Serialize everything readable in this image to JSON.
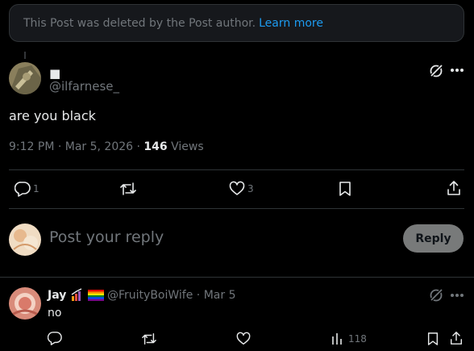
{
  "deleted_notice": {
    "text": "This Post was deleted by the Post author.",
    "link": "Learn more"
  },
  "post": {
    "author_name": "■",
    "author_handle": "@ilfarnese_",
    "text": "are you black",
    "time": "9:12 PM · Mar 5, 2026 · ",
    "views_count": "146",
    "views_label": " Views",
    "actions": {
      "replies": "1",
      "reposts": "",
      "likes": "3"
    }
  },
  "reply_composer": {
    "placeholder": "Post your reply",
    "button": "Reply"
  },
  "reply": {
    "name": "Jay",
    "handle_date": "@FruityBoiWife · Mar 5",
    "text": "no",
    "views": "118"
  },
  "colors": {
    "accent": "#1d9bf0",
    "muted": "#71767b",
    "background": "#000000"
  }
}
